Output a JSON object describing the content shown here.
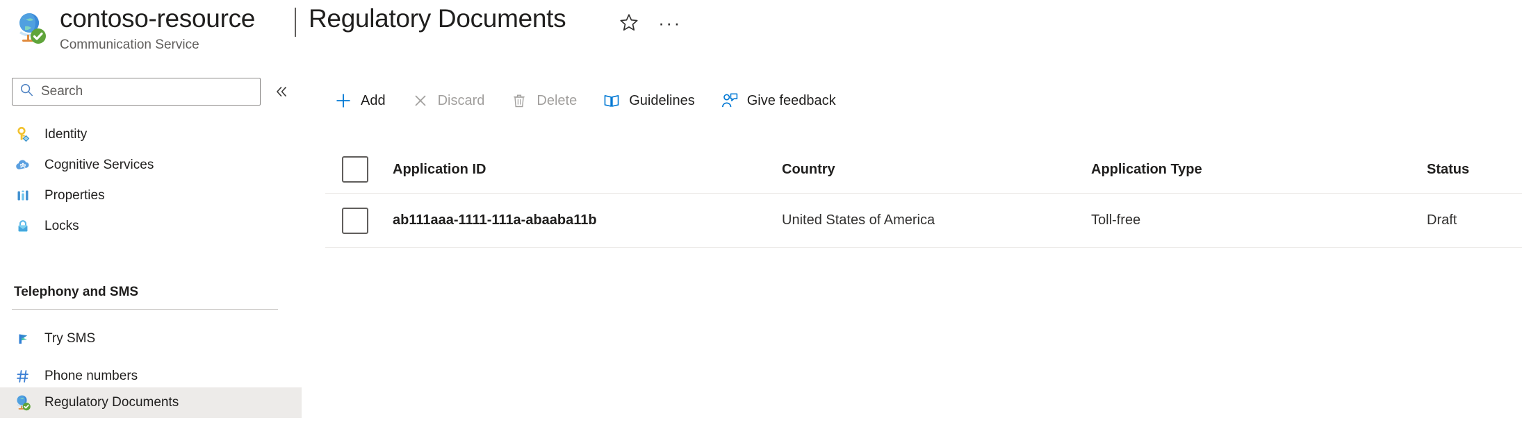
{
  "header": {
    "resource_name": "contoso-resource",
    "resource_type": "Communication Service",
    "separator": "|",
    "blade_title": "Regulatory Documents",
    "resource_icon": "communication-service-globe-icon",
    "favorite_icon": "star-outline-icon",
    "more_label": "···"
  },
  "sidebar": {
    "search": {
      "placeholder": "Search",
      "value": "",
      "icon": "search-icon"
    },
    "collapse_icon": "double-chevron-left-icon",
    "items": [
      {
        "label": "Identity",
        "icon": "key-icon",
        "selected": false
      },
      {
        "label": "Cognitive Services",
        "icon": "cognitive-services-icon",
        "selected": false
      },
      {
        "label": "Properties",
        "icon": "properties-bars-icon",
        "selected": false
      },
      {
        "label": "Locks",
        "icon": "lock-icon",
        "selected": false
      }
    ],
    "section": {
      "title": "Telephony and SMS"
    },
    "section_items": [
      {
        "label": "Try SMS",
        "icon": "flag-icon",
        "selected": false
      },
      {
        "label": "Phone numbers",
        "icon": "hash-icon",
        "selected": false
      },
      {
        "label": "Regulatory Documents",
        "icon": "regulatory-globe-icon",
        "selected": true
      }
    ]
  },
  "toolbar": {
    "commands": [
      {
        "label": "Add",
        "icon": "plus-icon",
        "enabled": true
      },
      {
        "label": "Discard",
        "icon": "cancel-x-icon",
        "enabled": false
      },
      {
        "label": "Delete",
        "icon": "trash-icon",
        "enabled": false
      },
      {
        "label": "Guidelines",
        "icon": "book-icon",
        "enabled": true
      },
      {
        "label": "Give feedback",
        "icon": "feedback-person-icon",
        "enabled": true
      }
    ]
  },
  "table": {
    "select_all_checked": false,
    "columns": [
      "Application ID",
      "Country",
      "Application Type",
      "Status"
    ],
    "rows": [
      {
        "checked": false,
        "application_id": "ab111aaa-1111-111a-abaaba11b",
        "country": "United States of America",
        "application_type": "Toll-free",
        "status": "Draft"
      }
    ]
  },
  "colors": {
    "accent": "#0078d4",
    "selected_row_bg": "#edebe9",
    "disabled_text": "#a19f9d",
    "divider": "#edebe9"
  }
}
